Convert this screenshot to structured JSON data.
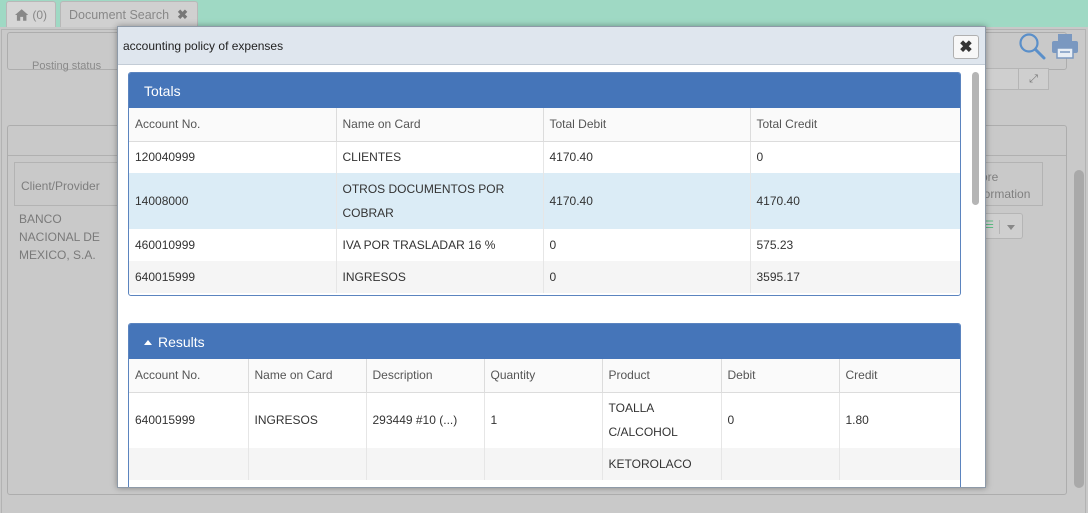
{
  "tabs": {
    "home": {
      "label": "(0)",
      "icon": "home-icon"
    },
    "document_search": {
      "label": "Document Search",
      "close": "✖"
    }
  },
  "background": {
    "posting_status_label": "Posting status",
    "client_provider_header": "Client/Provider",
    "client_value": "BANCO NACIONAL DE MEXICO, S.A.",
    "more_information_header": "More information",
    "expand_glyph": "⤢"
  },
  "modal": {
    "title": "accounting policy of expenses",
    "close_glyph": "✖",
    "totals": {
      "title": "Totals",
      "columns": [
        "Account No.",
        "Name on Card",
        "Total Debit",
        "Total Credit"
      ],
      "rows": [
        [
          "120040999",
          "CLIENTES",
          "4170.40",
          "0"
        ],
        [
          "14008000",
          "OTROS DOCUMENTOS POR COBRAR",
          "4170.40",
          "4170.40"
        ],
        [
          "460010999",
          "IVA POR TRASLADAR 16 %",
          "0",
          "575.23"
        ],
        [
          "640015999",
          "INGRESOS",
          "0",
          "3595.17"
        ]
      ]
    },
    "results": {
      "title": "Results",
      "columns": [
        "Account No.",
        "Name on Card",
        "Description",
        "Quantity",
        "Product",
        "Debit",
        "Credit"
      ],
      "rows": [
        [
          "640015999",
          "INGRESOS",
          "293449 #10 (...)",
          "1",
          "TOALLA C/ALCOHOL",
          "0",
          "1.80"
        ],
        [
          "",
          "",
          "",
          "",
          "KETOROLACO",
          "",
          ""
        ]
      ]
    }
  },
  "colors": {
    "topbar": "#9fd9c4",
    "card_header": "#4575b9",
    "selected_row": "#dbecf6"
  }
}
